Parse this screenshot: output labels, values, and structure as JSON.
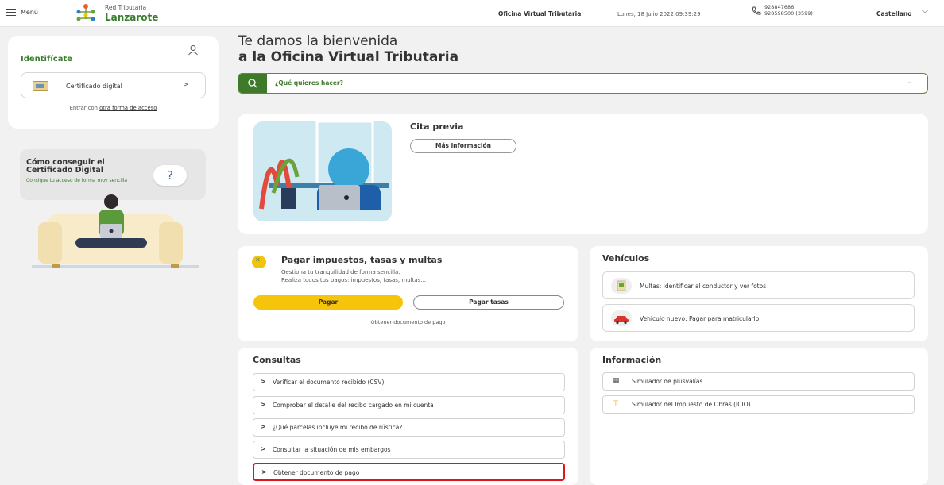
{
  "header": {
    "menu_label": "Menú",
    "logo_top": "Red Tributaria",
    "logo_name": "Lanzarote",
    "office": "Oficina Virtual Tributaria",
    "date": "Lunes, 18 Julio 2022 09:39:29",
    "phone1": "928847686",
    "phone2": "928598500 (3599)",
    "language": "Castellano"
  },
  "sidebar": {
    "identify_title": "Identifícate",
    "cert_button": "Certificado digital",
    "other_access_prefix": "Entrar con ",
    "other_access_link": "otra forma de acceso",
    "howto_title": "Cómo conseguir el Certificado Digital",
    "howto_sub": "Consigue tu acceso de forma muy sencilla",
    "help_glyph": "?"
  },
  "main": {
    "welcome_line1": "Te damos la bienvenida",
    "welcome_line2": "a la Oficina Virtual Tributaria",
    "search_placeholder": "¿Qué quieres hacer?",
    "cita": {
      "title": "Cita previa",
      "button": "Más información"
    },
    "pay": {
      "title": "Pagar impuestos, tasas y multas",
      "sub1": "Gestiona tu tranquilidad de forma sencilla.",
      "sub2": "Realiza todos tus pagos: impuestos, tasas, multas...",
      "btn_pay": "Pagar",
      "btn_fees": "Pagar tasas",
      "link": "Obtener documento de pago"
    },
    "vehicles": {
      "title": "Vehículos",
      "items": [
        "Multas: Identificar al conductor y ver fotos",
        "Vehiculo nuevo: Pagar para matricularlo"
      ]
    },
    "consultas": {
      "title": "Consultas",
      "items": [
        "Verificar el documento recibido (CSV)",
        "Comprobar el detalle del recibo cargado en mi cuenta",
        "¿Qué parcelas incluye mi recibo de rústica?",
        "Consultar la situación de mis embargos",
        "Obtener documento de pago"
      ],
      "highlighted_index": 4,
      "highlight_color": "#e0141e"
    },
    "info": {
      "title": "Información",
      "items": [
        "Simulador de plusvalías",
        "Simulador del Impuesto de Obras (ICIO)"
      ]
    }
  },
  "colors": {
    "brand_green": "#3a7d2c",
    "accent_yellow": "#f6c40a"
  }
}
